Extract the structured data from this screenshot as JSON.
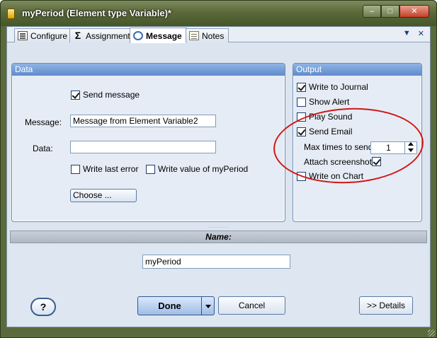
{
  "window": {
    "title": "myPeriod (Element type Variable)*",
    "controls": {
      "minimize": "–",
      "maximize": "□",
      "close": "✕"
    }
  },
  "tabs": [
    {
      "label": "Configure",
      "icon": "configure-icon"
    },
    {
      "label": "Assignment",
      "icon": "sigma-icon"
    },
    {
      "label": "Message",
      "icon": "message-icon",
      "active": true
    },
    {
      "label": "Notes",
      "icon": "notes-icon"
    }
  ],
  "tab_tools": {
    "dropdown": "▼",
    "close": "✕"
  },
  "data_panel": {
    "title": "Data",
    "send_message": {
      "label": "Send message",
      "checked": true
    },
    "message_label": "Message:",
    "message_value": "Message from Element Variable2",
    "data_label": "Data:",
    "data_value": "",
    "write_last_error": {
      "label": "Write last error",
      "checked": false
    },
    "write_value": {
      "label": "Write value of myPeriod",
      "checked": false
    },
    "choose_button": "Choose ..."
  },
  "output_panel": {
    "title": "Output",
    "write_to_journal": {
      "label": "Write to Journal",
      "checked": true
    },
    "show_alert": {
      "label": "Show Alert",
      "checked": false
    },
    "play_sound": {
      "label": "Play Sound",
      "checked": false
    },
    "send_email": {
      "label": "Send Email",
      "checked": true
    },
    "max_times_label": "Max times to send",
    "max_times_value": "1",
    "attach_screenshot": {
      "label": "Attach screenshot",
      "checked": true
    },
    "write_on_chart": {
      "label": "Write on Chart",
      "checked": false
    }
  },
  "splitter_dots": "..........",
  "name_section": {
    "header": "Name:",
    "value": "myPeriod"
  },
  "footer": {
    "help": "?",
    "done": "Done",
    "cancel": "Cancel",
    "details": ">> Details"
  },
  "colors": {
    "titlebar": "#5b6a3a",
    "panel_header": "#5f8bcc",
    "annotation": "#d11616"
  }
}
